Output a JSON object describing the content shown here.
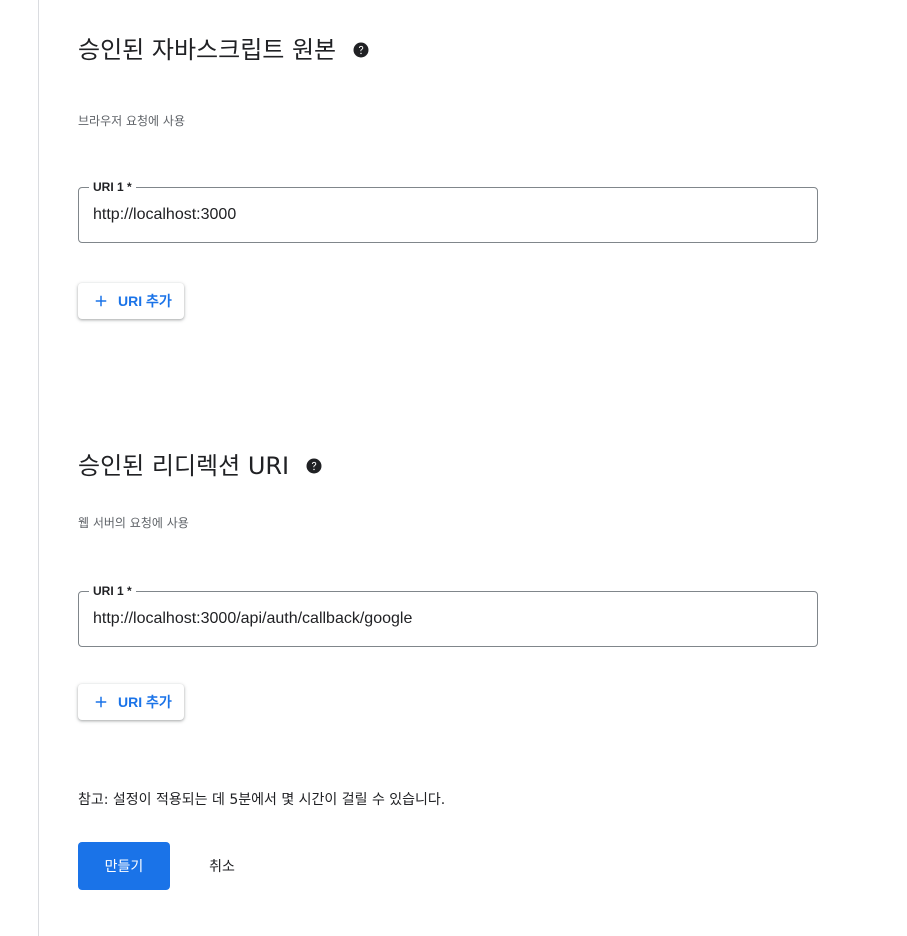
{
  "origins": {
    "title": "승인된 자바스크립트 원본",
    "subtitle": "브라우저 요청에 사용",
    "uri_field": {
      "label": "URI 1 *",
      "value": "http://localhost:3000"
    },
    "add_button_label": "URI 추가"
  },
  "redirects": {
    "title": "승인된 리디렉션 URI",
    "subtitle": "웹 서버의 요청에 사용",
    "uri_field": {
      "label": "URI 1 *",
      "value": "http://localhost:3000/api/auth/callback/google"
    },
    "add_button_label": "URI 추가"
  },
  "note": "참고: 설정이 적용되는 데 5분에서 몇 시간이 걸릴 수 있습니다.",
  "actions": {
    "create_label": "만들기",
    "cancel_label": "취소"
  },
  "icons": {
    "help": "help-circle-icon",
    "add": "plus-icon"
  },
  "colors": {
    "accent": "#1a73e8",
    "text": "#202124",
    "secondary_text": "#5f6368",
    "border": "#80868b"
  }
}
